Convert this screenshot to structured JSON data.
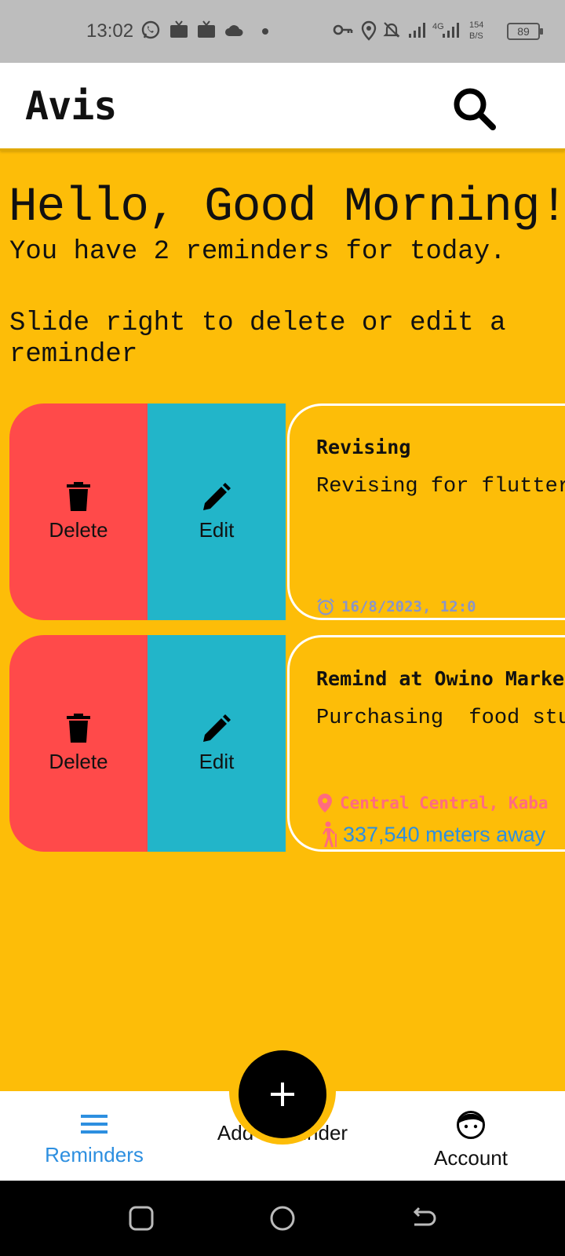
{
  "status_bar": {
    "time": "13:02",
    "network_type": "4G",
    "data_rate_value": "154",
    "data_rate_unit": "B/S",
    "battery": "89",
    "icons": [
      "whatsapp-icon",
      "tv-icon",
      "tv-icon",
      "cloud-icon",
      "dot-icon",
      "key-icon",
      "location-icon",
      "bell-off-icon",
      "signal-icon",
      "signal-4g-icon"
    ]
  },
  "appbar": {
    "title": "Avis",
    "search_icon": "search-icon"
  },
  "greeting": {
    "title": "Hello, Good Morning!",
    "subtitle": "You have 2 reminders for today.",
    "hint": "Slide right to delete or edit a reminder"
  },
  "reminders": [
    {
      "title": "Revising",
      "description": "Revising for flutter",
      "date": "16/8/2023, 12:0",
      "delete_label": "Delete",
      "edit_label": "Edit"
    },
    {
      "title": "Remind at Owino Marke",
      "description": "Purchasing  food stuf",
      "location": "Central Central, Kaba",
      "distance": "337,540 meters away",
      "delete_label": "Delete",
      "edit_label": "Edit"
    }
  ],
  "bottom_nav": {
    "reminders_label": "Reminders",
    "add_label": "Add Reminder",
    "account_label": "Account"
  },
  "colors": {
    "background": "#FDBD08",
    "delete": "#FF4A4A",
    "edit": "#22B5C9",
    "active_nav": "#2D8FE0",
    "location": "#FF6B7F",
    "date": "#8A95C8"
  }
}
